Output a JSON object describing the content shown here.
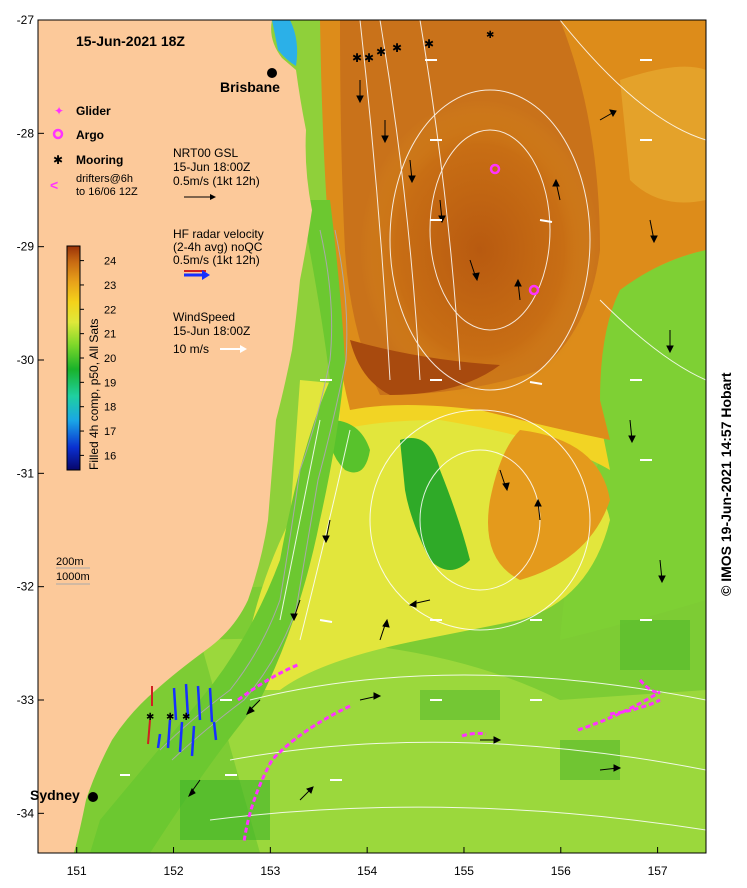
{
  "map": {
    "timestamp": "15-Jun-2021 18Z",
    "city_brisbane": "Brisbane",
    "city_sydney": "Sydney",
    "credit": "© IMOS 19-Jun-2021 14:57 Hobart",
    "lon_ticks": [
      "151",
      "152",
      "153",
      "154",
      "155",
      "156",
      "157"
    ],
    "lat_ticks": [
      "-27",
      "-28",
      "-29",
      "-30",
      "-31",
      "-32",
      "-33",
      "-34"
    ],
    "lon_range": [
      150.6,
      157.5
    ],
    "lat_range": [
      -34.35,
      -27.0
    ]
  },
  "legend": {
    "glider": "Glider",
    "argo": "Argo",
    "mooring": "Mooring",
    "drifters_line1": "drifters@6h",
    "drifters_line2": "to 16/06 12Z",
    "nrt_line1": "NRT00 GSL",
    "nrt_line2": "15-Jun 18:00Z",
    "nrt_line3": "0.5m/s (1kt 12h)",
    "hf_line1": "HF radar velocity",
    "hf_line2": "(2-4h avg) noQC",
    "hf_line3": "0.5m/s (1kt 12h)",
    "wind_line1": "WindSpeed",
    "wind_line2": "15-Jun 18:00Z",
    "wind_line3": "10 m/s",
    "depth_200": "200m",
    "depth_1000": "1000m"
  },
  "colorbar": {
    "title": "Filled 4h comp, p50, All Sats",
    "ticks": [
      "16",
      "17",
      "18",
      "19",
      "20",
      "21",
      "22",
      "23",
      "24"
    ],
    "range": [
      15.4,
      24.6
    ],
    "colors": [
      "#08066b",
      "#0a2fd0",
      "#1aa6e6",
      "#1fd0a0",
      "#19b22a",
      "#7fd82a",
      "#dfe83a",
      "#f4d21a",
      "#e8a21a",
      "#c86a12",
      "#9a3208"
    ]
  },
  "colors": {
    "land": "#fcc99a",
    "glider": "#ff33ff",
    "drifter": "#ff33ff",
    "hf_radar": "#1530ff",
    "mooring": "#000000"
  }
}
